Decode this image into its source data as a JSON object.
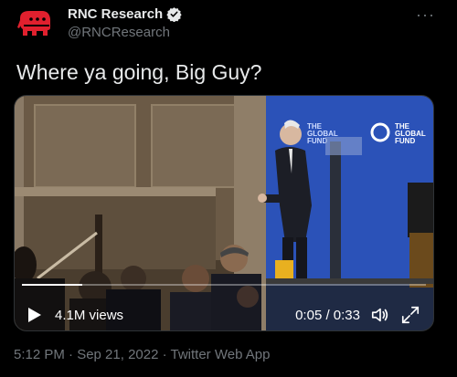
{
  "author": {
    "display_name": "RNC Research",
    "handle": "@RNCResearch",
    "avatar_icon": "gop-elephant-icon",
    "verified_icon": "verified-badge-icon",
    "verified_color": "#1d9bf0"
  },
  "more_label": "···",
  "tweet": {
    "text": "Where ya going, Big Guy?"
  },
  "video": {
    "views": "4.1M views",
    "time": "0:05 / 0:33",
    "progress_fraction": 0.15,
    "backdrop_text": [
      "THE",
      "GLOBAL",
      "FUND"
    ]
  },
  "meta": "5:12 PM · Sep 21, 2022 · Twitter Web App",
  "colors": {
    "background": "#000000",
    "text_primary": "#e7e9ea",
    "text_secondary": "#71767b",
    "avatar_red": "#e0202e",
    "backdrop_blue": "#2b52b8"
  }
}
